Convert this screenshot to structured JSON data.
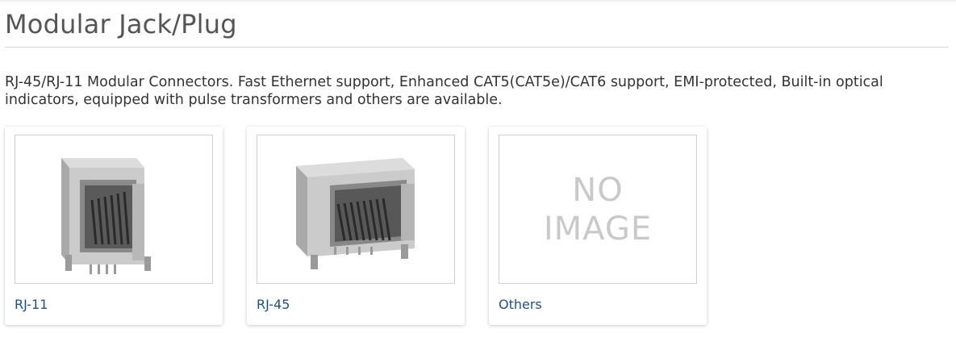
{
  "page": {
    "title": "Modular Jack/Plug",
    "description": "RJ-45/RJ-11 Modular Connectors. Fast Ethernet support, Enhanced CAT5(CAT5e)/CAT6 support, EMI-protected, Built-in optical indicators, equipped with pulse transformers and others are available."
  },
  "cards": [
    {
      "label": "RJ-11",
      "image": "rj11-connector-photo"
    },
    {
      "label": "RJ-45",
      "image": "rj45-connector-photo"
    },
    {
      "label": "Others",
      "image": "no-image-placeholder",
      "placeholder_lines": [
        "NO",
        "IMAGE"
      ]
    }
  ],
  "colors": {
    "link": "#1d4f8c",
    "title": "#555555",
    "text": "#333333",
    "placeholder": "#c9c9c9"
  }
}
